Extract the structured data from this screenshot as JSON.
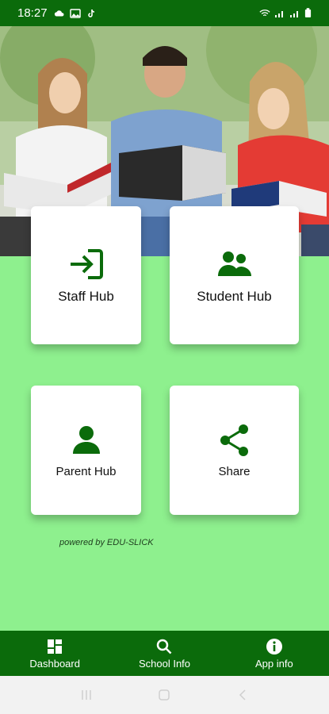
{
  "status_bar": {
    "time": "18:27",
    "left_icons": [
      "cloud-icon",
      "image-icon",
      "tiktok-icon"
    ],
    "right_icons": [
      "wifi-icon",
      "signal-icon",
      "signal-icon-2",
      "battery-icon"
    ]
  },
  "tiles": {
    "staff": {
      "label": "Staff Hub",
      "icon": "login-icon"
    },
    "student": {
      "label": "Student Hub",
      "icon": "group-icon"
    },
    "parent": {
      "label": "Parent Hub",
      "icon": "person-icon"
    },
    "share": {
      "label": "Share",
      "icon": "share-icon"
    }
  },
  "powered_by": "powered by EDU-SLICK",
  "bottom_nav": {
    "dashboard": {
      "label": "Dashboard",
      "icon": "dashboard-icon"
    },
    "school_info": {
      "label": "School Info",
      "icon": "search-icon"
    },
    "app_info": {
      "label": "App info",
      "icon": "info-icon"
    }
  },
  "colors": {
    "primary_dark": "#0b6b0b",
    "background": "#8ef08e",
    "icon_green": "#0b6b0b"
  }
}
